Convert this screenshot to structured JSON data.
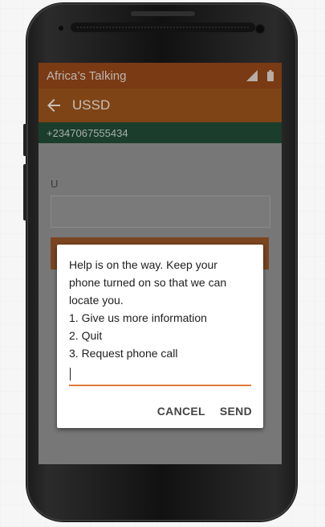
{
  "statusbar": {
    "app_title": "Africa’s Talking"
  },
  "toolbar": {
    "title": "USSD"
  },
  "numberbar": {
    "phone_number": "+2347067555434"
  },
  "background": {
    "field_label": "U"
  },
  "dialog": {
    "message_lines": [
      "Help is on the way. Keep your",
      "phone turned on so that we can",
      "locate you.",
      "1. Give us more information",
      "2. Quit",
      "3. Request phone call"
    ],
    "reply_value": "",
    "cancel_label": "CANCEL",
    "send_label": "SEND"
  },
  "colors": {
    "accent": "#e07a3a",
    "statusbar": "#7a3a14",
    "toolbar": "#7e4416",
    "numberbar": "#1b3d2c"
  }
}
